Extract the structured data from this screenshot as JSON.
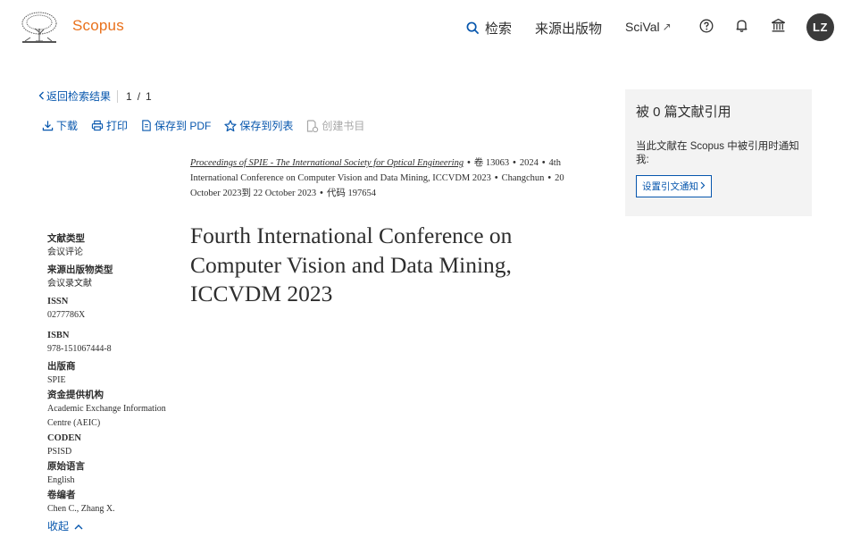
{
  "header": {
    "brand": "Scopus",
    "nav": {
      "search_label": "检索",
      "sources_label": "来源出版物",
      "scival_label": "SciVal",
      "scival_arrow": "↗"
    },
    "avatar_initials": "LZ",
    "icons": [
      "search-icon",
      "help-icon",
      "bell-icon",
      "institution-icon"
    ]
  },
  "backbar": {
    "back_label": "返回检索结果",
    "page_current": "1",
    "page_sep": "/",
    "page_total": "1"
  },
  "toolbar": {
    "download": "下载",
    "print": "打印",
    "save_pdf": "保存到 PDF",
    "save_list": "保存到列表",
    "create_bib": "创建书目"
  },
  "source": {
    "journal": "Proceedings of SPIE - The International Society for Optical Engineering",
    "volume": "卷 13063",
    "year": "2024",
    "conference": "4th International Conference on Computer Vision and Data Mining, ICCVDM 2023",
    "location": "Changchun",
    "dates": "20 October 2023到 22 October 2023",
    "code": "代码 197654",
    "dot": "•"
  },
  "title": {
    "line1": "Fourth International Conference on",
    "line2": "Computer Vision and Data Mining,",
    "line3": "ICCVDM 2023"
  },
  "meta": {
    "doc_type_label": "文献类型",
    "doc_type_value": "会议评论",
    "source_type_label": "来源出版物类型",
    "source_type_value": "会议录文献",
    "issn_label": "ISSN",
    "issn_value": "0277786X",
    "isbn_label": "ISBN",
    "isbn_value": "978-151067444-8",
    "publisher_label": "出版商",
    "publisher_value": "SPIE",
    "funding_label": "资金提供机构",
    "funding_value": "Academic Exchange Information Centre (AEIC)",
    "coden_label": "CODEN",
    "coden_value": "PSISD",
    "language_label": "原始语言",
    "language_value": "English",
    "editors_label": "卷编者",
    "editors_value": "Chen C., Zhang X.",
    "collapse_label": "收起"
  },
  "cite_panel": {
    "title": "被 0 篇文献引用",
    "desc": "当此文献在 Scopus 中被引用时通知我:",
    "button": "设置引文通知"
  },
  "colors": {
    "brand_orange": "#e9711c",
    "link_blue": "#0656ad",
    "panel_gray": "#f3f3f3",
    "avatar_bg": "#3a3a3a"
  }
}
